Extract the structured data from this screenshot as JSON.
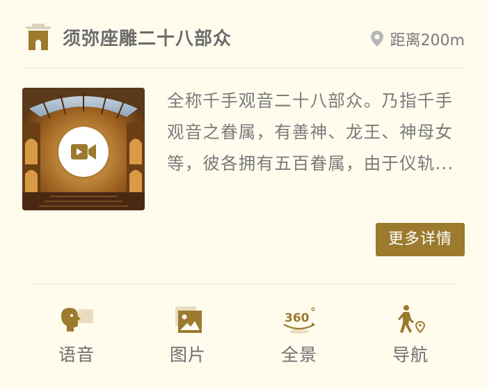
{
  "header": {
    "title": "须弥座雕二十八部众",
    "distance": "距离200m",
    "icon": "building-icon",
    "location_icon": "location-pin-icon"
  },
  "media": {
    "play_icon": "video-camera-icon"
  },
  "description": "全称千手观音二十八部众。乃指千手观音之眷属，有善神、龙王、神母女等，彼各拥有五百眷属，由于仪轨...",
  "more_button": "更多详情",
  "nav": {
    "items": [
      {
        "label": "语音",
        "icon": "audio-guide-icon"
      },
      {
        "label": "图片",
        "icon": "image-icon"
      },
      {
        "label": "全景",
        "icon": "panorama-360-icon"
      },
      {
        "label": "导航",
        "icon": "navigation-icon"
      }
    ]
  },
  "colors": {
    "accent": "#9c7a2e",
    "background": "#fffcee",
    "text": "#7a7a7a"
  }
}
